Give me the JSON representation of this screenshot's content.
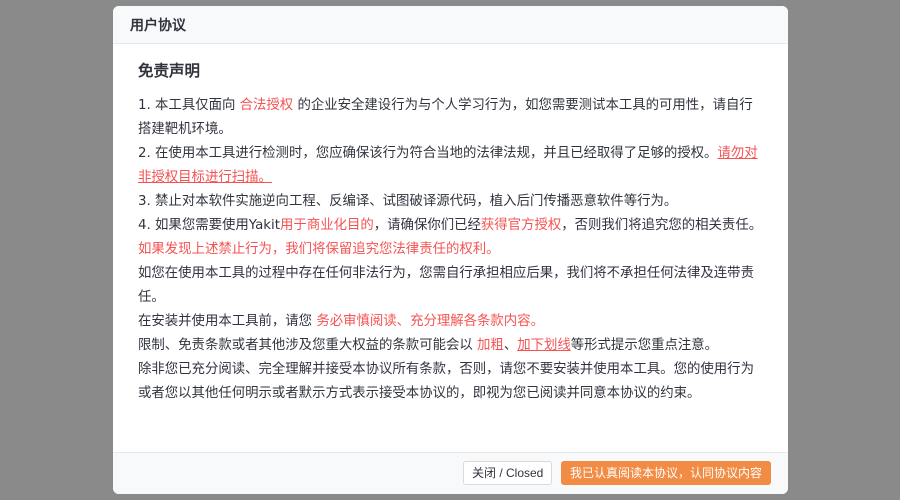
{
  "modal": {
    "title": "用户协议",
    "section_title": "免责声明",
    "p1": {
      "a": "1. 本工具仅面向 ",
      "b": "合法授权",
      "c": " 的企业安全建设行为与个人学习行为，如您需要测试本工具的可用性，请自行搭建靶机环境。"
    },
    "p2": {
      "a": "2. 在使用本工具进行检测时，您应确保该行为符合当地的法律法规，并且已经取得了足够的授权。",
      "b": "请勿对非授权目标进行扫描。"
    },
    "p3": "3. 禁止对本软件实施逆向工程、反编译、试图破译源代码，植入后门传播恶意软件等行为。",
    "p4": {
      "a": "4. 如果您需要使用Yakit",
      "b": "用于商业化目的",
      "c": "，请确保你们已经",
      "d": "获得官方授权",
      "e": "，否则我们将追究您的相关责任。"
    },
    "p5": "如果发现上述禁止行为，我们将保留追究您法律责任的权利。",
    "p6": "如您在使用本工具的过程中存在任何非法行为，您需自行承担相应后果，我们将不承担任何法律及连带责任。",
    "p7": {
      "a": "在安装并使用本工具前，请您 ",
      "b": "务必审慎阅读、充分理解各条款内容。"
    },
    "p8": {
      "a": "限制、免责条款或者其他涉及您重大权益的条款可能会以 ",
      "b": "加粗",
      "c": "、",
      "d": "加下划线",
      "e": "等形式提示您重点注意。"
    },
    "p9": "除非您已充分阅读、完全理解并接受本协议所有条款，否则，请您不要安装并使用本工具。您的使用行为或者您以其他任何明示或者默示方式表示接受本协议的，即视为您已阅读并同意本协议的约束。"
  },
  "footer": {
    "close_label": "关闭 / Closed",
    "agree_label": "我已认真阅读本协议，认同协议内容"
  },
  "colors": {
    "accent": "#f28b44",
    "highlight_red": "#f55353",
    "text": "#31343f",
    "overlay": "#8a8a8a"
  }
}
